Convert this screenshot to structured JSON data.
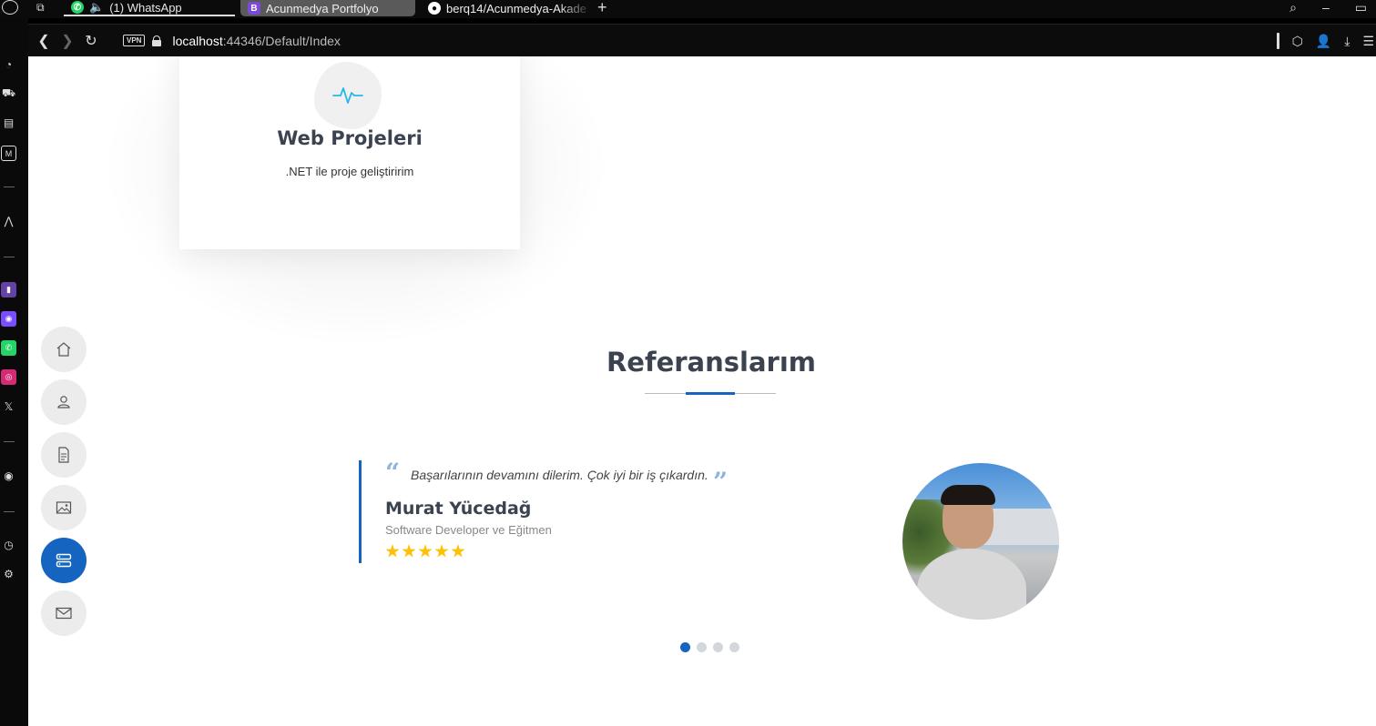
{
  "browser": {
    "tabs": [
      {
        "label": "(1) WhatsApp"
      },
      {
        "label": "Acunmedya Portfolyo"
      },
      {
        "label": "berq14/Acunmedya-Akade"
      }
    ],
    "address": {
      "vpn_label": "VPN",
      "host": "localhost",
      "rest": ":44346/Default/Index"
    }
  },
  "service_card": {
    "icon": "pulse-icon",
    "title": "Web Projeleri",
    "description": ".NET ile proje geliştiririm"
  },
  "references": {
    "title": "Referanslarım",
    "testimonial": {
      "quote": "Başarılarının devamını dilerim. Çok iyi bir iş çıkardın.",
      "name": "Murat Yücedağ",
      "role": "Software Developer ve Eğitmen",
      "rating": 5
    },
    "pagination": {
      "count": 4,
      "active": 1
    }
  },
  "side_nav": {
    "items": [
      "home-icon",
      "user-icon",
      "document-icon",
      "image-icon",
      "server-icon",
      "mail-icon"
    ],
    "active": "server-icon"
  },
  "colors": {
    "accent": "#1565c0",
    "star": "#ffc107",
    "heading": "#3b4350"
  }
}
